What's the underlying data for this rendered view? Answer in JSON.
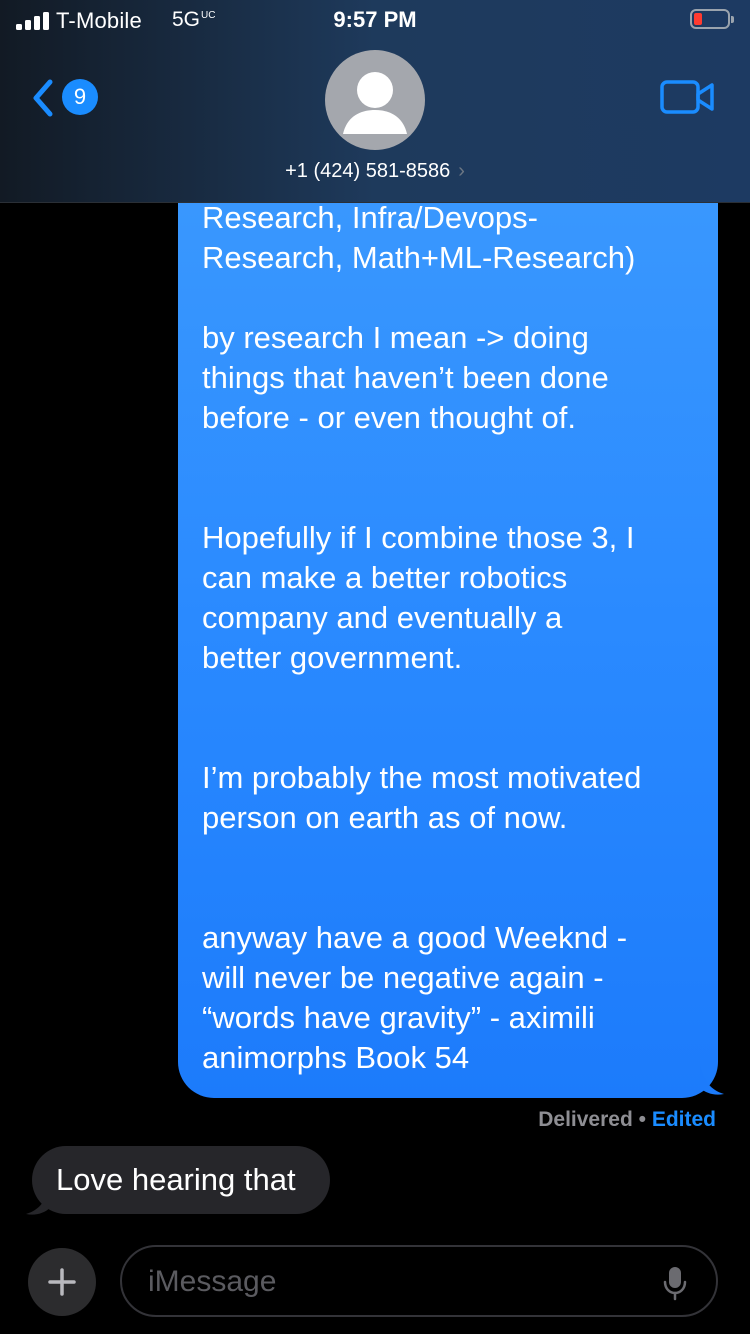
{
  "status_bar": {
    "carrier": "T-Mobile",
    "network": "5G",
    "network_suffix": "UC",
    "time": "9:57 PM",
    "battery_level": 0.15,
    "signal_icon": "signal-bars-icon"
  },
  "header": {
    "back_count": "9",
    "contact": "+1 (424) 581-8586",
    "contact_chevron": "›",
    "back_icon": "chevron-left-icon",
    "facetime_icon": "video-camera-icon"
  },
  "conversation": {
    "outgoing": {
      "lines_1": [
        "Research,  Infra/Devops-",
        "Research, Math+ML-Research)"
      ],
      "para_2": [
        "by research I mean -> doing",
        "things that haven’t been done",
        "before - or even thought of."
      ],
      "para_3": [
        "Hopefully if I combine those 3, I",
        "can make a better robotics",
        "company and eventually a",
        "better government."
      ],
      "para_4": [
        "I’m probably the most motivated",
        "person on earth as of now."
      ],
      "para_5": [
        "anyway have a good Weeknd -",
        "will never be negative again -",
        "“words have gravity” - aximili",
        "animorphs Book 54"
      ]
    },
    "delivered_label": "Delivered",
    "separator": "•",
    "edited_label": "Edited",
    "incoming": {
      "text": "Love hearing that"
    }
  },
  "composer": {
    "placeholder": "iMessage",
    "plus_icon": "plus-icon",
    "mic_icon": "microphone-icon"
  },
  "colors": {
    "bubble_blue": "#1c7bfb",
    "accent": "#1a8cff",
    "incoming_bubble": "#26262a"
  }
}
